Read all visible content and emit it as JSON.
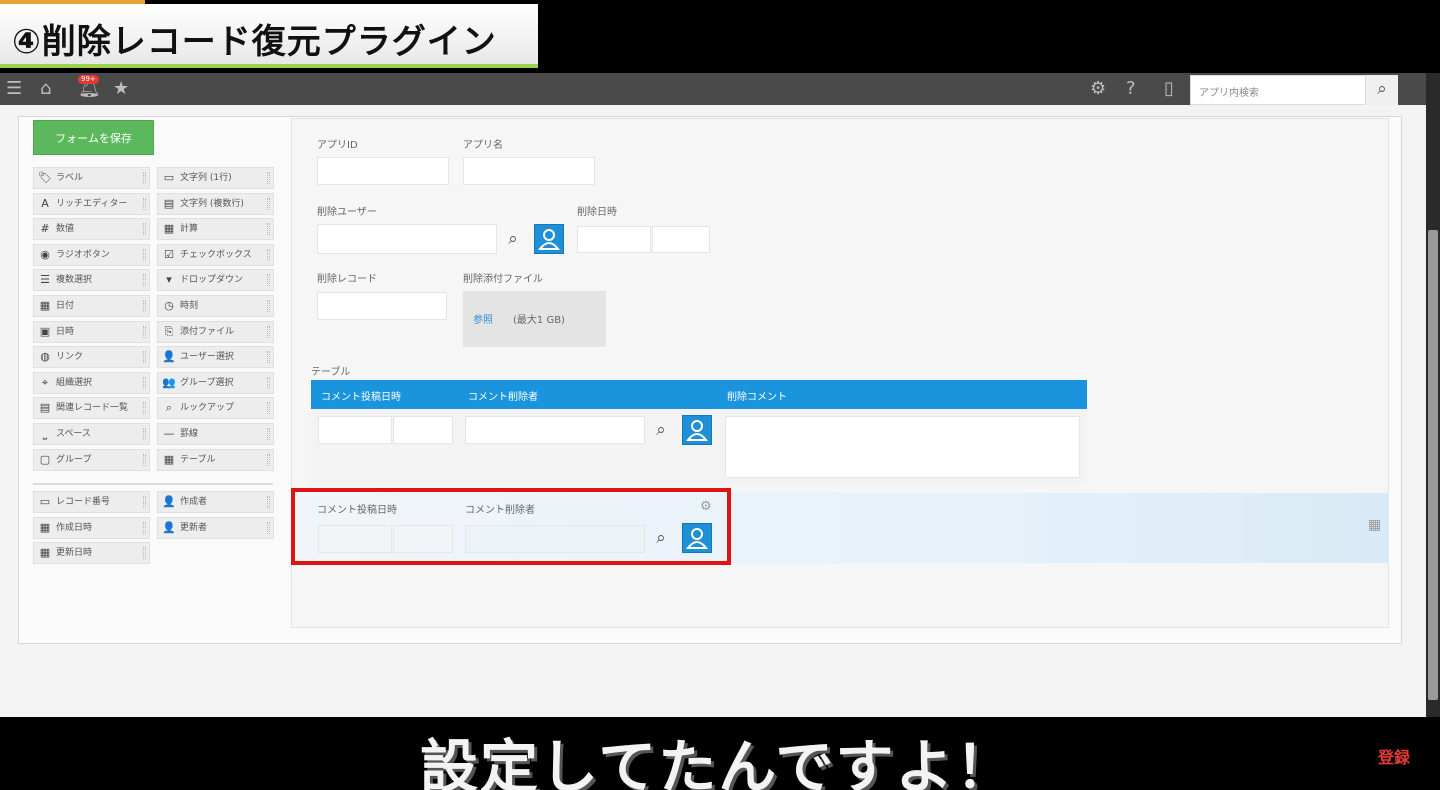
{
  "video": {
    "title": "④削除レコード復元プラグイン",
    "subtitle": "設定してたんですよ！",
    "register_label": "登録"
  },
  "navbar": {
    "notification_badge": "99+",
    "search_placeholder": "アプリ内検索",
    "icons": [
      "menu-icon",
      "home-icon",
      "bell-icon",
      "star-icon",
      "gear-icon",
      "help-icon",
      "mobile-icon",
      "search-icon"
    ]
  },
  "editor": {
    "save_button": "フォームを保存",
    "palette_left": [
      "ラベル",
      "リッチエディター",
      "数値",
      "ラジオボタン",
      "複数選択",
      "日付",
      "日時",
      "リンク",
      "組織選択",
      "関連レコード一覧",
      "スペース",
      "グループ"
    ],
    "palette_right": [
      "文字列 (1行)",
      "文字列 (複数行)",
      "計算",
      "チェックボックス",
      "ドロップダウン",
      "時刻",
      "添付ファイル",
      "ユーザー選択",
      "グループ選択",
      "ルックアップ",
      "罫線",
      "テーブル"
    ],
    "palette_system_left": [
      "レコード番号",
      "作成日時",
      "更新日時"
    ],
    "palette_system_right": [
      "作成者",
      "更新者"
    ]
  },
  "form": {
    "app_id_label": "アプリID",
    "app_name_label": "アプリ名",
    "deleted_user_label": "削除ユーザー",
    "deleted_datetime_label": "削除日時",
    "deleted_record_label": "削除レコード",
    "deleted_attachment_label": "削除添付ファイル",
    "attachment_browse": "参照",
    "attachment_max": "(最大1 GB)",
    "table_label": "テーブル",
    "table_columns": [
      "コメント投稿日時",
      "コメント削除者",
      "削除コメント"
    ],
    "dragging_labels": [
      "コメント投稿日時",
      "コメント削除者"
    ]
  }
}
